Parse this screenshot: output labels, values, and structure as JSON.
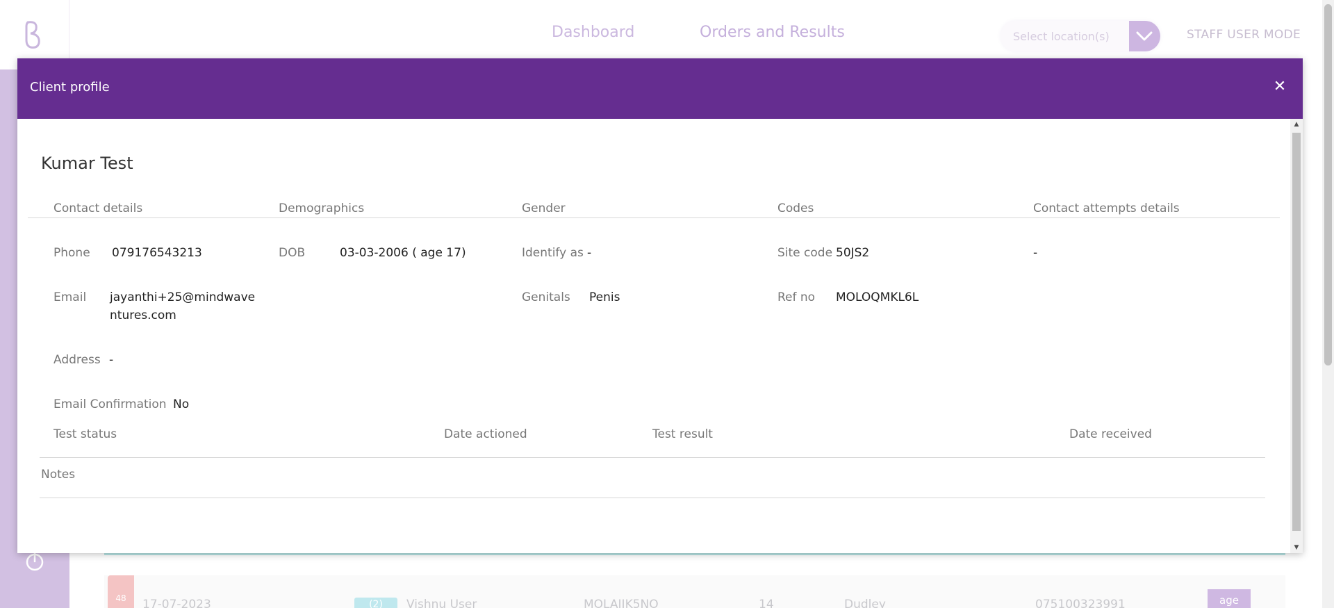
{
  "nav": {
    "dashboard": "Dashboard",
    "orders": "Orders and Results",
    "location_placeholder": "Select location(s)",
    "staff_mode": "STAFF USER MODE"
  },
  "background_row": {
    "badge": "48",
    "date": "17-07-2023",
    "chip": "(2)",
    "user": "Vishnu User",
    "ref": "MOLAIIK5NO",
    "count": "14",
    "place": "Dudley",
    "phone": "075100323991",
    "tag": "age"
  },
  "modal": {
    "title": "Client profile",
    "client_name": "Kumar Test",
    "sections": {
      "contact": "Contact details",
      "demographics": "Demographics",
      "gender": "Gender",
      "codes": "Codes",
      "contact_attempts": "Contact attempts details"
    },
    "contact": {
      "phone_label": "Phone",
      "phone": "079176543213",
      "email_label": "Email",
      "email": "jayanthi+25@mindwaventures.com",
      "address_label": "Address",
      "address": "-",
      "email_confirmation_label": "Email Confirmation",
      "email_confirmation": "No"
    },
    "demographics": {
      "dob_label": "DOB",
      "dob": "03-03-2006 ( age 17)"
    },
    "gender": {
      "identify_label": "Identify as",
      "identify": "-",
      "genitals_label": "Genitals",
      "genitals": "Penis"
    },
    "codes": {
      "site_label": "Site code",
      "site": "50JS2",
      "ref_label": "Ref no",
      "ref": "MOLOQMKL6L"
    },
    "contact_attempts": {
      "value": "-"
    },
    "table": {
      "test_status": "Test status",
      "date_actioned": "Date actioned",
      "test_result": "Test result",
      "date_received": "Date received"
    },
    "notes_label": "Notes"
  },
  "colors": {
    "header": "#652d90",
    "sidebar": "#d2c0e2"
  },
  "icons": {
    "logo": "brand-logo-icon",
    "close": "close-icon",
    "power": "power-icon",
    "dropdown": "chevron-down-icon"
  }
}
